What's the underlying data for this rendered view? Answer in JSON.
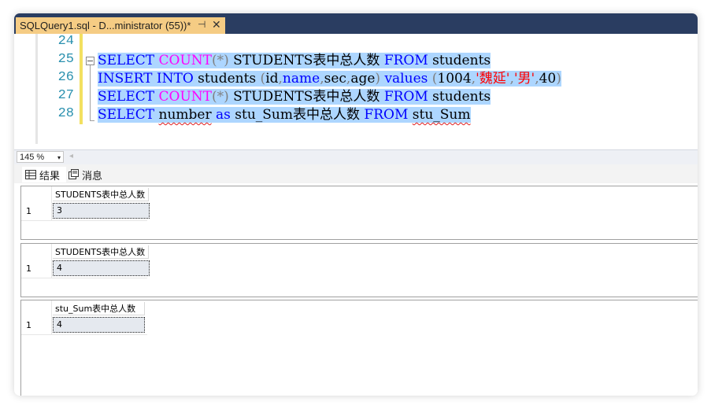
{
  "tab": {
    "title": "SQLQuery1.sql - D...ministrator (55))*",
    "pin": "⊣",
    "close": "✕"
  },
  "editor": {
    "line_numbers": [
      "24",
      "25",
      "26",
      "27",
      "28"
    ],
    "lines": [
      {
        "segments": []
      },
      {
        "segments": [
          {
            "t": "SELECT",
            "c": "kw"
          },
          {
            "t": " "
          },
          {
            "t": "COUNT",
            "c": "fn"
          },
          {
            "t": "(*)",
            "c": "gy"
          },
          {
            "t": " STUDENTS表中总人数 "
          },
          {
            "t": "FROM",
            "c": "kw"
          },
          {
            "t": " students"
          }
        ]
      },
      {
        "segments": [
          {
            "t": "INSERT",
            "c": "kw"
          },
          {
            "t": " "
          },
          {
            "t": "INTO",
            "c": "kw"
          },
          {
            "t": " students "
          },
          {
            "t": "(",
            "c": "gy"
          },
          {
            "t": "id"
          },
          {
            "t": ",",
            "c": "gy"
          },
          {
            "t": "name",
            "c": "kw"
          },
          {
            "t": ",",
            "c": "gy"
          },
          {
            "t": "sec"
          },
          {
            "t": ",",
            "c": "gy"
          },
          {
            "t": "age"
          },
          {
            "t": ")",
            "c": "gy"
          },
          {
            "t": " "
          },
          {
            "t": "values",
            "c": "kw"
          },
          {
            "t": " "
          },
          {
            "t": "(",
            "c": "gy"
          },
          {
            "t": "1004"
          },
          {
            "t": ",",
            "c": "gy"
          },
          {
            "t": "'魏延'",
            "c": "st"
          },
          {
            "t": ",",
            "c": "gy"
          },
          {
            "t": "'男'",
            "c": "st"
          },
          {
            "t": ",",
            "c": "gy"
          },
          {
            "t": "40"
          },
          {
            "t": ")",
            "c": "gy"
          }
        ]
      },
      {
        "segments": [
          {
            "t": "SELECT",
            "c": "kw"
          },
          {
            "t": " "
          },
          {
            "t": "COUNT",
            "c": "fn"
          },
          {
            "t": "(*)",
            "c": "gy"
          },
          {
            "t": " STUDENTS表中总人数 "
          },
          {
            "t": "FROM",
            "c": "kw"
          },
          {
            "t": " students"
          }
        ]
      },
      {
        "segments": [
          {
            "t": "SELECT",
            "c": "kw"
          },
          {
            "t": " "
          },
          {
            "t": "number",
            "c": "sq"
          },
          {
            "t": " "
          },
          {
            "t": "as",
            "c": "kw"
          },
          {
            "t": " stu_Sum表中总人数 "
          },
          {
            "t": "FROM",
            "c": "kw"
          },
          {
            "t": " "
          },
          {
            "t": "stu_Sum",
            "c": "sq"
          }
        ]
      }
    ]
  },
  "status": {
    "zoom": "145 %",
    "zoom_arrow": "▾",
    "scroll_left": "◂"
  },
  "result_tabs": {
    "results": "结果",
    "messages": "消息"
  },
  "grids": [
    {
      "header": "STUDENTS表中总人数",
      "row": "1",
      "value": "3"
    },
    {
      "header": "STUDENTS表中总人数",
      "row": "1",
      "value": "4"
    },
    {
      "header": "stu_Sum表中总人数",
      "row": "1",
      "value": "4"
    }
  ]
}
